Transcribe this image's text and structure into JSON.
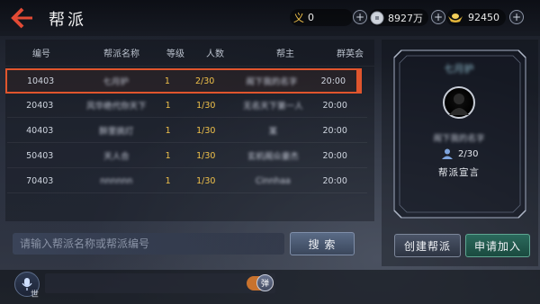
{
  "header": {
    "title": "帮派",
    "resources": [
      {
        "icon": "yi-symbol-icon",
        "symbol": "义",
        "value": "0"
      },
      {
        "icon": "silver-coin-icon",
        "value": "8927万"
      },
      {
        "icon": "gold-ingot-icon",
        "value": "92450"
      }
    ],
    "plus": "+"
  },
  "table": {
    "columns": [
      "编号",
      "帮派名称",
      "等级",
      "人数",
      "帮主",
      "群英会"
    ],
    "rows": [
      {
        "id": "10403",
        "name": "七月护",
        "level": "1",
        "members": "2/30",
        "leader": "阁下我的名字",
        "time": "20:00"
      },
      {
        "id": "20403",
        "name": "风华绝代你天下",
        "level": "1",
        "members": "1/30",
        "leader": "无名天下第一人",
        "time": "20:00"
      },
      {
        "id": "40403",
        "name": "醉里挑灯",
        "level": "1",
        "members": "1/30",
        "leader": "某",
        "time": "20:00"
      },
      {
        "id": "50403",
        "name": "天人合",
        "level": "1",
        "members": "1/30",
        "leader": "玄机阁众豪杰",
        "time": "20:00"
      },
      {
        "id": "70403",
        "name": "nnnnnn",
        "level": "1",
        "members": "1/30",
        "leader": "Cinnhaa",
        "time": "20:00"
      }
    ]
  },
  "search": {
    "placeholder": "请输入帮派名称或帮派编号",
    "button": "搜 索"
  },
  "detail": {
    "name": "七月护",
    "leader": "阁下我的名字",
    "members": "2/30",
    "motto_label": "帮派宣言"
  },
  "actions": {
    "create": "创建帮派",
    "apply": "申请加入"
  },
  "chat": {
    "channel": "世",
    "toggle": "弹"
  }
}
